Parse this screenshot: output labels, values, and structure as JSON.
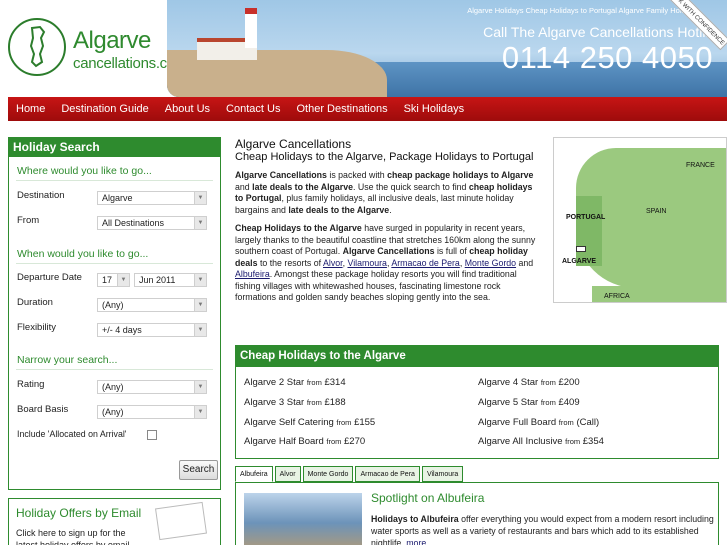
{
  "header": {
    "logo_line1": "Algarve",
    "logo_line2": "cancellations.co.uk",
    "top_links": "Algarve Holidays  Cheap Holidays to Portugal  Algarve Family Holidays",
    "tagline": "Call The Algarve Cancellations Hotline",
    "phone": "0114 250 4050",
    "badge": "BOOK WITH CONFIDENCE"
  },
  "nav": [
    "Home",
    "Destination Guide",
    "About Us",
    "Contact Us",
    "Other Destinations",
    "Ski Holidays"
  ],
  "search": {
    "title": "Holiday Search",
    "where_heading": "When would you like to go...",
    "where_q": "Where would you like to go...",
    "destination_label": "Destination",
    "destination_value": "Algarve",
    "from_label": "From",
    "from_value": "All Destinations",
    "departure_label": "Departure Date",
    "departure_day": "17",
    "departure_month": "Jun 2011",
    "duration_label": "Duration",
    "duration_value": "(Any)",
    "flexibility_label": "Flexibility",
    "flexibility_value": "+/- 4 days",
    "narrow_heading": "Narrow your search...",
    "rating_label": "Rating",
    "rating_value": "(Any)",
    "board_label": "Board Basis",
    "board_value": "(Any)",
    "allocated_label": "Include 'Allocated on Arrival'",
    "button": "Search"
  },
  "offers": {
    "title": "Holiday Offers by Email",
    "desc": "Click here to sign up for the latest holiday offers by email"
  },
  "intro": {
    "title": "Algarve Cancellations",
    "subtitle": "Cheap Holidays to the Algarve, Package Holidays to Portugal",
    "p1_a": "Algarve Cancellations",
    "p1_b": " is packed with ",
    "p1_c": "cheap package holidays to Algarve",
    "p1_d": " and ",
    "p1_e": "late deals to the Algarve",
    "p1_f": ". Use the quick search to find ",
    "p1_g": "cheap holidays to Portugal",
    "p1_h": ", plus family holidays, all inclusive deals, last minute holiday bargains and ",
    "p1_i": "late deals to the Algarve",
    "p1_j": ".",
    "p2_a": "Cheap Holidays to the Algarve",
    "p2_b": " have surged in popularity in recent years, largely thanks to the beautiful coastline that stretches 160km along the sunny southern coast of Portugal. ",
    "p2_c": "Algarve Cancellations",
    "p2_d": " is full of ",
    "p2_e": "cheap holiday deals",
    "p2_f": " to the resorts of ",
    "r1": "Alvor",
    "r2": "Vilamoura",
    "r3": "Armacao de Pera",
    "r4": "Monte Gordo",
    "r5": "Albufeira",
    "p2_g": ". Amongst these package holiday resorts you will find traditional fishing villages with whitewashed houses, fascinating limestone rock formations and golden sandy beaches sloping gently into the sea."
  },
  "map": {
    "france": "FRANCE",
    "spain": "SPAIN",
    "portugal": "PORTUGAL",
    "algarve": "ALGARVE",
    "africa": "AFRICA"
  },
  "cheap": {
    "title": "Cheap Holidays to the Algarve",
    "from": "from",
    "items": [
      {
        "name": "Algarve 2 Star",
        "price": "£314"
      },
      {
        "name": "Algarve 4 Star",
        "price": "£200"
      },
      {
        "name": "Algarve 3 Star",
        "price": "£188"
      },
      {
        "name": "Algarve 5 Star",
        "price": "£409"
      },
      {
        "name": "Algarve Self Catering",
        "price": "£155"
      },
      {
        "name": "Algarve Full Board",
        "price": "(Call)"
      },
      {
        "name": "Algarve Half Board",
        "price": "£270"
      },
      {
        "name": "Algarve All Inclusive",
        "price": "£354"
      }
    ]
  },
  "tabs": [
    "Albufeira",
    "Alvor",
    "Monte Gordo",
    "Armacao de Pera",
    "Vilamoura"
  ],
  "spotlight": {
    "title": "Spotlight on Albufeira",
    "lead": "Holidays to Albufeira",
    "text": " offer everything you would expect from a modern resort including water sports as well as a variety of restaurants and bars which add to its established nightlife. ",
    "more": "more"
  }
}
